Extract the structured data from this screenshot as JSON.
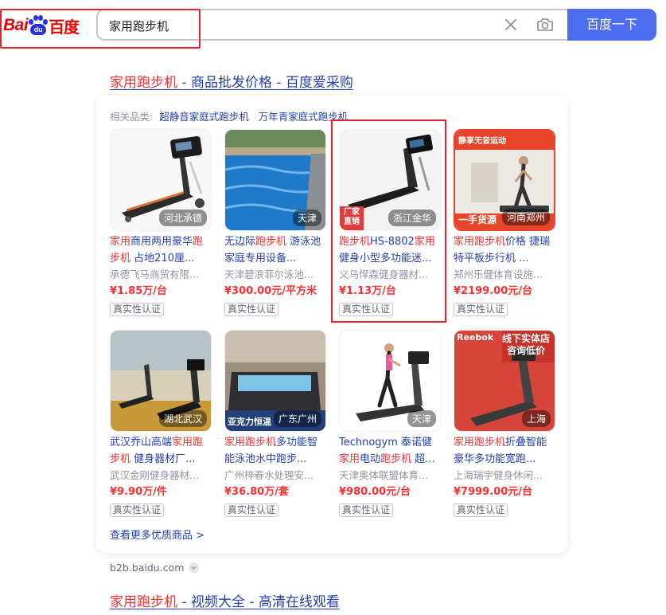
{
  "header": {
    "logo_text": "Bai",
    "logo_paw_text": "du",
    "logo_cn": "百度",
    "search_value": "家用跑步机",
    "search_button": "百度一下",
    "icons": [
      "clear-icon",
      "camera-icon"
    ]
  },
  "result1": {
    "title_em": "家用跑步机",
    "title_rest": " - 商品批发价格 - 百度爱采购",
    "related_label": "相关品类:",
    "related_links": [
      "超静音家庭式跑步机",
      "万年青家庭式跑步机"
    ],
    "more_link": "查看更多优质商品 >",
    "source": "b2b.baidu.com",
    "products": [
      {
        "location": "河北承德",
        "name_parts": [
          {
            "t": "家用",
            "em": true
          },
          {
            "t": "商用两用豪华",
            "em": false
          },
          {
            "t": "跑步机",
            "em": true
          },
          {
            "t": " 占地210厘...",
            "em": false
          }
        ],
        "seller": "承德飞马商贸有限...",
        "price": "¥1.85万/台",
        "badge": "真实性认证"
      },
      {
        "location": "天津",
        "name_parts": [
          {
            "t": "无边际",
            "em": false
          },
          {
            "t": "跑步机",
            "em": true
          },
          {
            "t": " 游泳池 家庭专用设备...",
            "em": false
          }
        ],
        "seller": "天津碧浪菲尔泳池...",
        "price": "¥300.00元/平方米",
        "badge": "真实性认证"
      },
      {
        "location": "浙江金华",
        "image_overlay": "厂家直销",
        "name_parts": [
          {
            "t": "跑步机",
            "em": true
          },
          {
            "t": "HS-8802",
            "em": false
          },
          {
            "t": "家用",
            "em": true
          },
          {
            "t": "健身小型多功能迷...",
            "em": false
          }
        ],
        "seller": "义乌悍森健身器材...",
        "price": "¥1.13万/台",
        "badge": "真实性认证"
      },
      {
        "location": "河南郑州",
        "image_overlay_top": "静享无音运动",
        "image_overlay": "一手货源",
        "name_parts": [
          {
            "t": "家用跑步机",
            "em": true
          },
          {
            "t": "价格 捷瑞特平板步行机 ...",
            "em": false
          }
        ],
        "seller": "郑州乐健体育设施...",
        "price": "¥2199.00元/台",
        "badge": "真实性认证"
      },
      {
        "location": "湖北武汉",
        "name_parts": [
          {
            "t": "武汉乔山高端",
            "em": false
          },
          {
            "t": "家用跑步机",
            "em": true
          },
          {
            "t": " 健身器材厂...",
            "em": false
          }
        ],
        "seller": "武汉金刚健身器材...",
        "price": "¥9.90万/件",
        "badge": "真实性认证"
      },
      {
        "location": "广东广州",
        "image_overlay": "亚克力恒温",
        "name_parts": [
          {
            "t": "家用跑步机",
            "em": true
          },
          {
            "t": "多功能智能泳池水中跑步...",
            "em": false
          }
        ],
        "seller": "广州梓春水处理安...",
        "price": "¥36.80万/套",
        "badge": "真实性认证"
      },
      {
        "location": "天津",
        "name_parts": [
          {
            "t": "Technogym 泰诺健",
            "em": false
          },
          {
            "t": "家用",
            "em": true
          },
          {
            "t": "电动",
            "em": false
          },
          {
            "t": "跑步机",
            "em": true
          },
          {
            "t": " 超...",
            "em": false
          }
        ],
        "seller": "天津奥体联盟体育...",
        "price": "¥980.00元/台",
        "badge": "真实性认证"
      },
      {
        "location": "上海",
        "image_brand": "Reebok",
        "image_overlay": "线下实体店 咨询低价",
        "name_parts": [
          {
            "t": "家用跑步机",
            "em": true
          },
          {
            "t": "折叠智能豪华多功能宽跑...",
            "em": false
          }
        ],
        "seller": "上海瑞宇健身休闲...",
        "price": "¥7999.00元/台",
        "badge": "真实性认证"
      }
    ]
  },
  "result2": {
    "title_em": "家用跑步机",
    "title_rest": " - 视频大全 - 高清在线观看"
  },
  "colors": {
    "accent": "#4e6ef2",
    "link": "#2440b3",
    "highlight": "#f73131",
    "annotation": "#e8222c"
  }
}
